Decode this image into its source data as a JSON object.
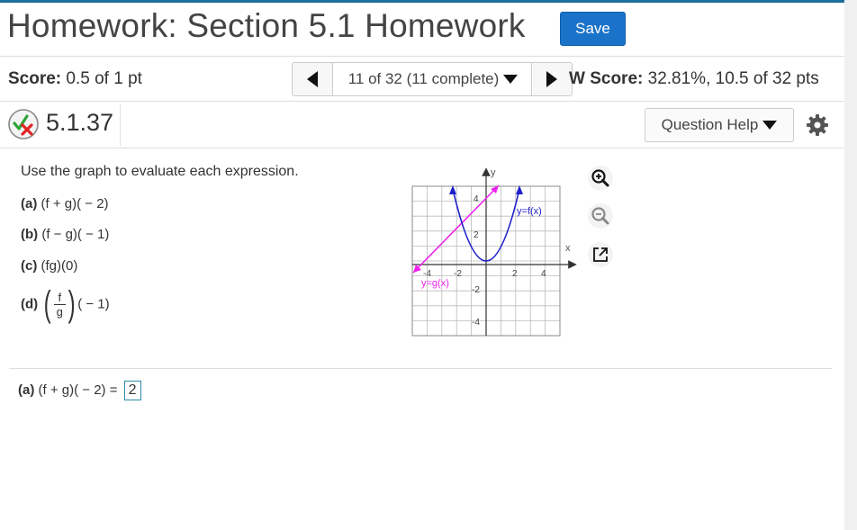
{
  "header": {
    "title": "Homework: Section 5.1 Homework",
    "save_label": "Save"
  },
  "score_bar": {
    "score_label": "Score:",
    "score_value": "0.5 of 1 pt",
    "nav_label": "11 of 32 (11 complete)",
    "hw_score_label": "W Score:",
    "hw_score_value": "32.81%, 10.5 of 32 pts"
  },
  "question_bar": {
    "question_number": "5.1.37",
    "help_label": "Question Help"
  },
  "question": {
    "instruction": "Use the graph to evaluate each expression.",
    "parts": [
      {
        "label": "(a)",
        "expr": "(f + g)( − 2)"
      },
      {
        "label": "(b)",
        "expr": "(f − g)( − 1)"
      },
      {
        "label": "(c)",
        "expr": "(fg)(0)"
      },
      {
        "label": "(d)",
        "num": "f",
        "den": "g",
        "expr": "( − 1)"
      }
    ]
  },
  "graph": {
    "x_axis_label": "x",
    "y_axis_label": "y",
    "tick_labels": {
      "x": [
        "-4",
        "-2",
        "2",
        "4"
      ],
      "y": [
        "4",
        "2",
        "-2",
        "-4"
      ]
    },
    "f_label": "y=f(x)",
    "g_label": "y=g(x)",
    "f_color": "#1f1fcc",
    "g_color": "#ee22ee"
  },
  "answer": {
    "label": "(a)",
    "expr": "(f + g)( − 2) =",
    "value": "2"
  }
}
